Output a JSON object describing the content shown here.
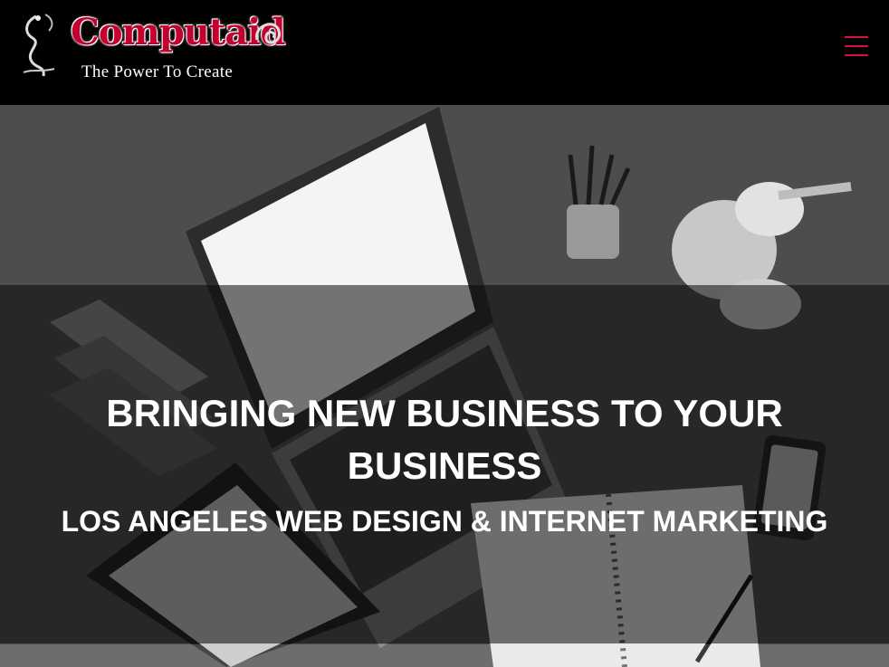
{
  "header": {
    "logo": {
      "title": "Computaid",
      "tagline": "The Power To Create"
    },
    "menu_icon": "hamburger-menu-icon",
    "accent_color": "#d9113f"
  },
  "hero": {
    "heading": "BRINGING NEW BUSINESS TO YOUR BUSINESS",
    "subheading": "LOS ANGELES WEB DESIGN & INTERNET MARKETING"
  }
}
